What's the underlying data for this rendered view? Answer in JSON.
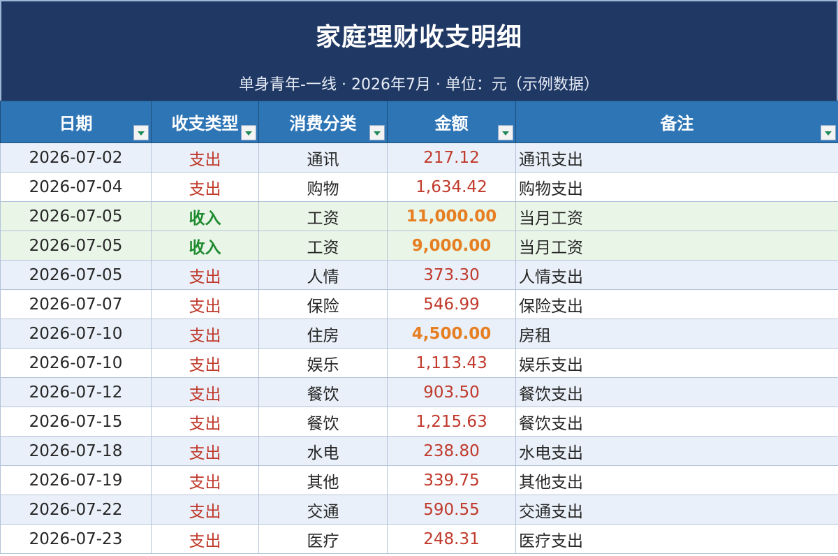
{
  "header": {
    "title": "家庭理财收支明细",
    "subtitle": "单身青年-一线 · 2026年7月 · 单位：元（示例数据）"
  },
  "columns": [
    "日期",
    "收支类型",
    "消费分类",
    "金额",
    "备注"
  ],
  "rows": [
    {
      "date": "2026-07-02",
      "type": "支出",
      "category": "通讯",
      "amount": "217.12",
      "note": "通讯支出",
      "kind": "out",
      "highlight": false
    },
    {
      "date": "2026-07-04",
      "type": "支出",
      "category": "购物",
      "amount": "1,634.42",
      "note": "购物支出",
      "kind": "out",
      "highlight": false
    },
    {
      "date": "2026-07-05",
      "type": "收入",
      "category": "工资",
      "amount": "11,000.00",
      "note": "当月工资",
      "kind": "in",
      "highlight": true
    },
    {
      "date": "2026-07-05",
      "type": "收入",
      "category": "工资",
      "amount": "9,000.00",
      "note": "当月工资",
      "kind": "in",
      "highlight": true
    },
    {
      "date": "2026-07-05",
      "type": "支出",
      "category": "人情",
      "amount": "373.30",
      "note": "人情支出",
      "kind": "out",
      "highlight": false
    },
    {
      "date": "2026-07-07",
      "type": "支出",
      "category": "保险",
      "amount": "546.99",
      "note": "保险支出",
      "kind": "out",
      "highlight": false
    },
    {
      "date": "2026-07-10",
      "type": "支出",
      "category": "住房",
      "amount": "4,500.00",
      "note": "房租",
      "kind": "out",
      "highlight": true
    },
    {
      "date": "2026-07-10",
      "type": "支出",
      "category": "娱乐",
      "amount": "1,113.43",
      "note": "娱乐支出",
      "kind": "out",
      "highlight": false
    },
    {
      "date": "2026-07-12",
      "type": "支出",
      "category": "餐饮",
      "amount": "903.50",
      "note": "餐饮支出",
      "kind": "out",
      "highlight": false
    },
    {
      "date": "2026-07-15",
      "type": "支出",
      "category": "餐饮",
      "amount": "1,215.63",
      "note": "餐饮支出",
      "kind": "out",
      "highlight": false
    },
    {
      "date": "2026-07-18",
      "type": "支出",
      "category": "水电",
      "amount": "238.80",
      "note": "水电支出",
      "kind": "out",
      "highlight": false
    },
    {
      "date": "2026-07-19",
      "type": "支出",
      "category": "其他",
      "amount": "339.75",
      "note": "其他支出",
      "kind": "out",
      "highlight": false
    },
    {
      "date": "2026-07-22",
      "type": "支出",
      "category": "交通",
      "amount": "590.55",
      "note": "交通支出",
      "kind": "out",
      "highlight": false
    },
    {
      "date": "2026-07-23",
      "type": "支出",
      "category": "医疗",
      "amount": "248.31",
      "note": "医疗支出",
      "kind": "out",
      "highlight": false
    }
  ],
  "colors": {
    "title_bg": "#1f3864",
    "header_bg": "#2e75b6",
    "expense_text": "#c0392b",
    "income_text": "#1e8a2e",
    "large_amount_text": "#e67e22",
    "stripe": "#eaf0f9",
    "income_row": "#e9f5e7"
  }
}
